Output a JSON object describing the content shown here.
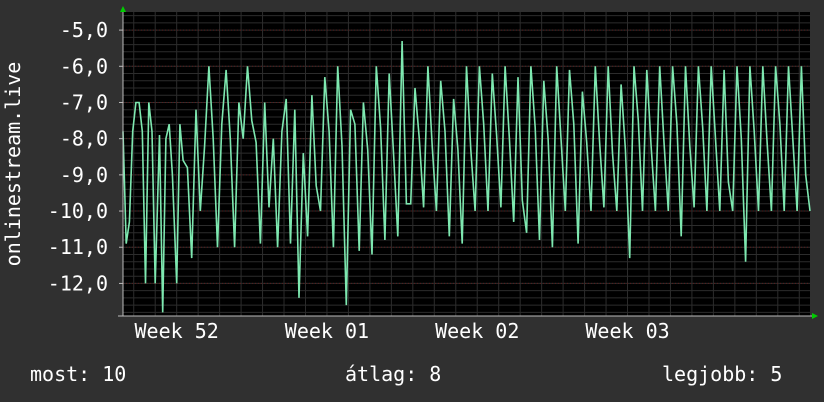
{
  "chart_data": {
    "type": "line",
    "ylabel": "onlinestream.live",
    "y_ticks": [
      "-5,0",
      "-6,0",
      "-7,0",
      "-8,0",
      "-9,0",
      "-10,0",
      "-11,0",
      "-12,0"
    ],
    "y_tick_values": [
      -5,
      -6,
      -7,
      -8,
      -9,
      -10,
      -11,
      -12
    ],
    "ylim": [
      -12.9,
      -4.5
    ],
    "x_ticks": [
      "Week 52",
      "Week 01",
      "Week 02",
      "Week 03"
    ],
    "x_tick_positions": [
      0.5,
      7.5,
      14.5,
      21.5
    ],
    "xlim": [
      -2,
      30
    ],
    "grid": true,
    "colors": {
      "background": "#303030",
      "plot": "#000000",
      "line": "#7ee8b0",
      "grid": "#2c2c2c",
      "vgrid": "#5a1d1d",
      "axis": "#bbbbbb",
      "arrow": "#00cc00"
    },
    "series": [
      {
        "x": [
          -2,
          -1.85,
          -1.7,
          -1.55,
          -1.4,
          -1.25,
          -1.1,
          -0.95,
          -0.8,
          -0.65,
          -0.5,
          -0.3,
          -0.15,
          0,
          0.15,
          0.3,
          0.5,
          0.65,
          0.8,
          1,
          1.2,
          1.4,
          1.6,
          1.8,
          2,
          2.2,
          2.4,
          2.6,
          2.8,
          3,
          3.2,
          3.4,
          3.6,
          3.8,
          4,
          4.2,
          4.4,
          4.6,
          4.8,
          5,
          5.2,
          5.4,
          5.6,
          5.8,
          6,
          6.2,
          6.4,
          6.6,
          6.8,
          7,
          7.2,
          7.4,
          7.6,
          7.8,
          8,
          8.2,
          8.4,
          8.6,
          8.8,
          9,
          9.2,
          9.4,
          9.6,
          9.8,
          10,
          10.2,
          10.4,
          10.6,
          10.8,
          11,
          11.2,
          11.4,
          11.6,
          11.8,
          12,
          12.2,
          12.4,
          12.6,
          12.8,
          13,
          13.2,
          13.4,
          13.6,
          13.8,
          14,
          14.2,
          14.4,
          14.6,
          14.8,
          15,
          15.2,
          15.4,
          15.6,
          15.8,
          16,
          16.2,
          16.4,
          16.6,
          16.8,
          17,
          17.2,
          17.4,
          17.6,
          17.8,
          18,
          18.2,
          18.4,
          18.6,
          18.8,
          19,
          19.2,
          19.4,
          19.6,
          19.8,
          20,
          20.2,
          20.4,
          20.6,
          20.8,
          21,
          21.2,
          21.4,
          21.6,
          21.8,
          22,
          22.2,
          22.4,
          22.6,
          22.8,
          23,
          23.2,
          23.4,
          23.6,
          23.8,
          24,
          24.2,
          24.4,
          24.6,
          24.8,
          25,
          25.2,
          25.4,
          25.6,
          25.8,
          26,
          26.2,
          26.4,
          26.6,
          26.8,
          27,
          27.2,
          27.4,
          27.6,
          27.8,
          28,
          28.2,
          28.4,
          28.6,
          28.8,
          29,
          29.2,
          29.4,
          29.6,
          29.8,
          30
        ],
        "y": [
          -7.8,
          -10.9,
          -10.3,
          -7.8,
          -7.0,
          -7.0,
          -7.8,
          -12.0,
          -7.0,
          -7.8,
          -12.0,
          -7.9,
          -12.8,
          -8.0,
          -7.6,
          -9.0,
          -12.0,
          -7.6,
          -8.6,
          -8.8,
          -11.3,
          -7.2,
          -10.0,
          -8.2,
          -6.0,
          -8.0,
          -11.0,
          -7.6,
          -6.1,
          -8.0,
          -11.0,
          -7.0,
          -8.0,
          -6.0,
          -7.5,
          -8.1,
          -10.9,
          -7.0,
          -9.9,
          -8.0,
          -11.0,
          -7.8,
          -6.9,
          -10.9,
          -7.2,
          -12.4,
          -8.4,
          -10.7,
          -6.8,
          -9.3,
          -10.0,
          -6.3,
          -7.8,
          -11.0,
          -6.0,
          -8.2,
          -12.6,
          -7.2,
          -7.6,
          -11.1,
          -7.0,
          -8.3,
          -11.2,
          -6.0,
          -7.7,
          -10.8,
          -6.2,
          -8.4,
          -10.7,
          -5.3,
          -9.8,
          -9.8,
          -6.6,
          -8.0,
          -9.9,
          -6.0,
          -8.2,
          -10.0,
          -6.4,
          -7.8,
          -10.7,
          -6.9,
          -8.3,
          -10.9,
          -6.0,
          -8.3,
          -10.0,
          -6.0,
          -7.6,
          -10.0,
          -6.2,
          -7.9,
          -9.9,
          -6.0,
          -8.0,
          -10.3,
          -6.3,
          -9.7,
          -10.6,
          -6.0,
          -7.7,
          -10.8,
          -6.4,
          -8.0,
          -11.0,
          -6.0,
          -8.0,
          -10.0,
          -6.1,
          -7.6,
          -10.9,
          -6.7,
          -8.1,
          -10.0,
          -6.0,
          -8.1,
          -9.9,
          -6.0,
          -8.4,
          -10.0,
          -6.5,
          -8.3,
          -11.3,
          -6.0,
          -7.5,
          -10.0,
          -6.1,
          -8.2,
          -10.0,
          -6.0,
          -8.1,
          -10.0,
          -6.0,
          -7.6,
          -10.7,
          -6.0,
          -8.2,
          -9.9,
          -6.0,
          -7.7,
          -10.0,
          -6.0,
          -8.0,
          -10.0,
          -6.1,
          -9.2,
          -10.0,
          -6.0,
          -8.0,
          -11.4,
          -6.0,
          -7.8,
          -10.0,
          -6.0,
          -8.1,
          -10.0,
          -6.0,
          -7.6,
          -10.0,
          -6.0,
          -8.0,
          -10.0,
          -6.0,
          -9.0,
          -10.0
        ]
      }
    ]
  },
  "footer": {
    "current_label": "most: 10",
    "average_label": "átlag: 8",
    "best_label": "legjobb: 5"
  }
}
